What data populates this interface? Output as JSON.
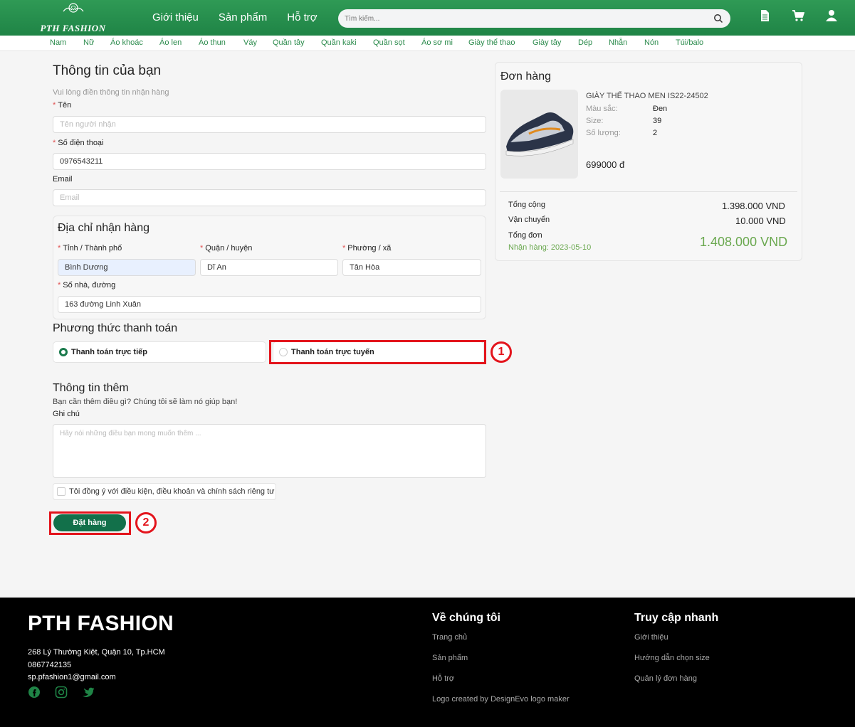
{
  "header": {
    "logo_text": "PTH FASHION",
    "nav": [
      "Giới thiệu",
      "Sản phẩm",
      "Hỗ trợ"
    ],
    "search_placeholder": "Tìm kiếm...",
    "icons": [
      "document-icon",
      "cart-icon",
      "user-icon"
    ]
  },
  "categories": [
    "Nam",
    "Nữ",
    "Áo khoác",
    "Áo len",
    "Áo thun",
    "Váy",
    "Quần tây",
    "Quần kaki",
    "Quần sọt",
    "Áo sơ mi",
    "Giày thể thao",
    "Giày tây",
    "Dép",
    "Nhẫn",
    "Nón",
    "Túi/balo"
  ],
  "form": {
    "title": "Thông tin của bạn",
    "subtitle": "Vui lòng điền thông tin nhận hàng",
    "name_label": "Tên",
    "name_placeholder": "Tên người nhận",
    "phone_label": "Số điện thoại",
    "phone_value": "0976543211",
    "email_label": "Email",
    "email_placeholder": "Email",
    "address": {
      "title": "Địa chỉ nhận hàng",
      "city_label": "Tỉnh / Thành phố",
      "city_value": "Bình Dương",
      "district_label": "Quận / huyện",
      "district_value": "Dĩ An",
      "ward_label": "Phường / xã",
      "ward_value": "Tân Hòa",
      "street_label": "Số nhà, đường",
      "street_value": "163 đường Linh Xuân"
    },
    "payment": {
      "title": "Phương thức thanh toán",
      "option_direct": "Thanh toán trực tiếp",
      "option_online": "Thanh toán trực tuyến",
      "selected": "Thanh toán trực tiếp"
    },
    "extra": {
      "title": "Thông tin thêm",
      "subtitle": "Bạn cần thêm điều gì? Chúng tôi sẽ làm nó giúp bạn!",
      "note_label": "Ghi chú",
      "note_placeholder": "Hãy nói những điều bạn mong muốn thêm ..."
    },
    "agree_text": "Tôi đồng ý với điều kiện, điều khoản và chính sách riêng tư",
    "submit_label": "Đặt hàng"
  },
  "annotations": [
    "1",
    "2"
  ],
  "order": {
    "title": "Đơn hàng",
    "product_name": "GIÀY THỂ THAO MEN IS22-24502",
    "color_label": "Màu sắc:",
    "color_value": "Đen",
    "size_label": "Size:",
    "size_value": "39",
    "qty_label": "Số lượng:",
    "qty_value": "2",
    "price": "699000 đ",
    "subtotal_label": "Tổng cộng",
    "subtotal_value": "1.398.000 VND",
    "shipping_label": "Vận chuyển",
    "shipping_value": "10.000 VND",
    "total_label": "Tổng đơn",
    "total_value": "1.408.000 VND",
    "delivery_text": "Nhận hàng: 2023-05-10"
  },
  "footer": {
    "brand": "PTH FASHION",
    "address": "268 Lý Thường Kiệt, Quận 10, Tp.HCM",
    "phone": "0867742135",
    "email": "sp.pfashion1@gmail.com",
    "about_title": "Về chúng tôi",
    "about_links": [
      "Trang chủ",
      "Sản phẩm",
      "Hỗ trợ",
      "Logo created by DesignEvo logo maker"
    ],
    "quick_title": "Truy cập nhanh",
    "quick_links": [
      "Giới thiệu",
      "Hướng dẫn chọn size",
      "Quản lý đơn hàng"
    ]
  },
  "colors": {
    "brand_green": "#1f8446",
    "button_green": "#12704a",
    "total_green": "#6aa84f",
    "annotation_red": "#e3141c"
  }
}
